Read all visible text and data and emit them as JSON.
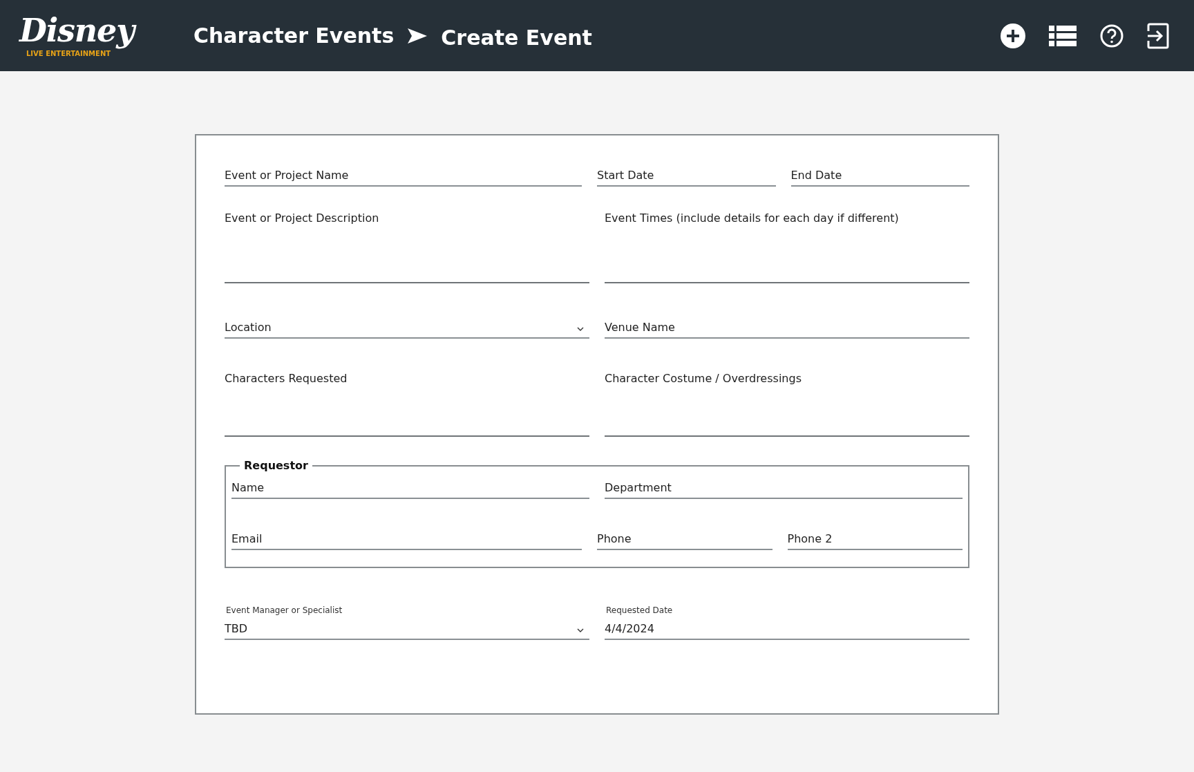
{
  "header": {
    "logo": {
      "wordmark": "Disney",
      "tagline": "LIVE ENTERTAINMENT"
    },
    "breadcrumb": [
      "Character Events",
      "Create Event"
    ]
  },
  "form": {
    "rows": [
      {
        "fields": [
          {
            "kind": "input",
            "placeholder": "Event or Project Name"
          },
          {
            "kind": "input",
            "placeholder": "Start Date"
          },
          {
            "kind": "input",
            "placeholder": "End Date"
          }
        ]
      },
      {
        "fields": [
          {
            "kind": "textarea",
            "placeholder": "Event or Project Description"
          },
          {
            "kind": "textarea",
            "placeholder": "Event Times (include details for each day if different)"
          }
        ]
      },
      {
        "fields": [
          {
            "kind": "select",
            "placeholder": "Location"
          },
          {
            "kind": "input",
            "placeholder": "Venue Name"
          }
        ]
      },
      {
        "fields": [
          {
            "kind": "textarea",
            "placeholder": "Characters Requested"
          },
          {
            "kind": "textarea",
            "placeholder": "Character Costume / Overdressings"
          }
        ]
      }
    ],
    "requestor": {
      "legend": "Requestor",
      "rows": [
        {
          "fields": [
            {
              "kind": "input",
              "placeholder": "Name"
            },
            {
              "kind": "input",
              "placeholder": "Department"
            }
          ]
        },
        {
          "fields": [
            {
              "kind": "input",
              "placeholder": "Email"
            },
            {
              "kind": "input",
              "placeholder": "Phone"
            },
            {
              "kind": "input",
              "placeholder": "Phone 2"
            }
          ]
        }
      ]
    },
    "bottom_rows": [
      {
        "fields": [
          {
            "kind": "select",
            "label": "Event Manager or Specialist",
            "value": "TBD"
          },
          {
            "kind": "input",
            "label": "Requested Date",
            "value": "4/4/2024"
          }
        ]
      }
    ]
  }
}
